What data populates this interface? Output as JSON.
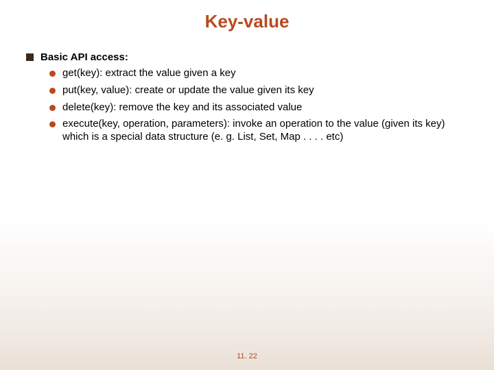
{
  "title": "Key-value",
  "top_item": "Basic API access:",
  "sub_items": [
    "get(key): extract the value given a key",
    "put(key, value): create or update the value given its key",
    "delete(key): remove the key and its associated value",
    "execute(key, operation, parameters): invoke an operation to the value (given its key) which is a special data structure (e. g. List, Set, Map . . . . etc)"
  ],
  "footer": "11. 22"
}
